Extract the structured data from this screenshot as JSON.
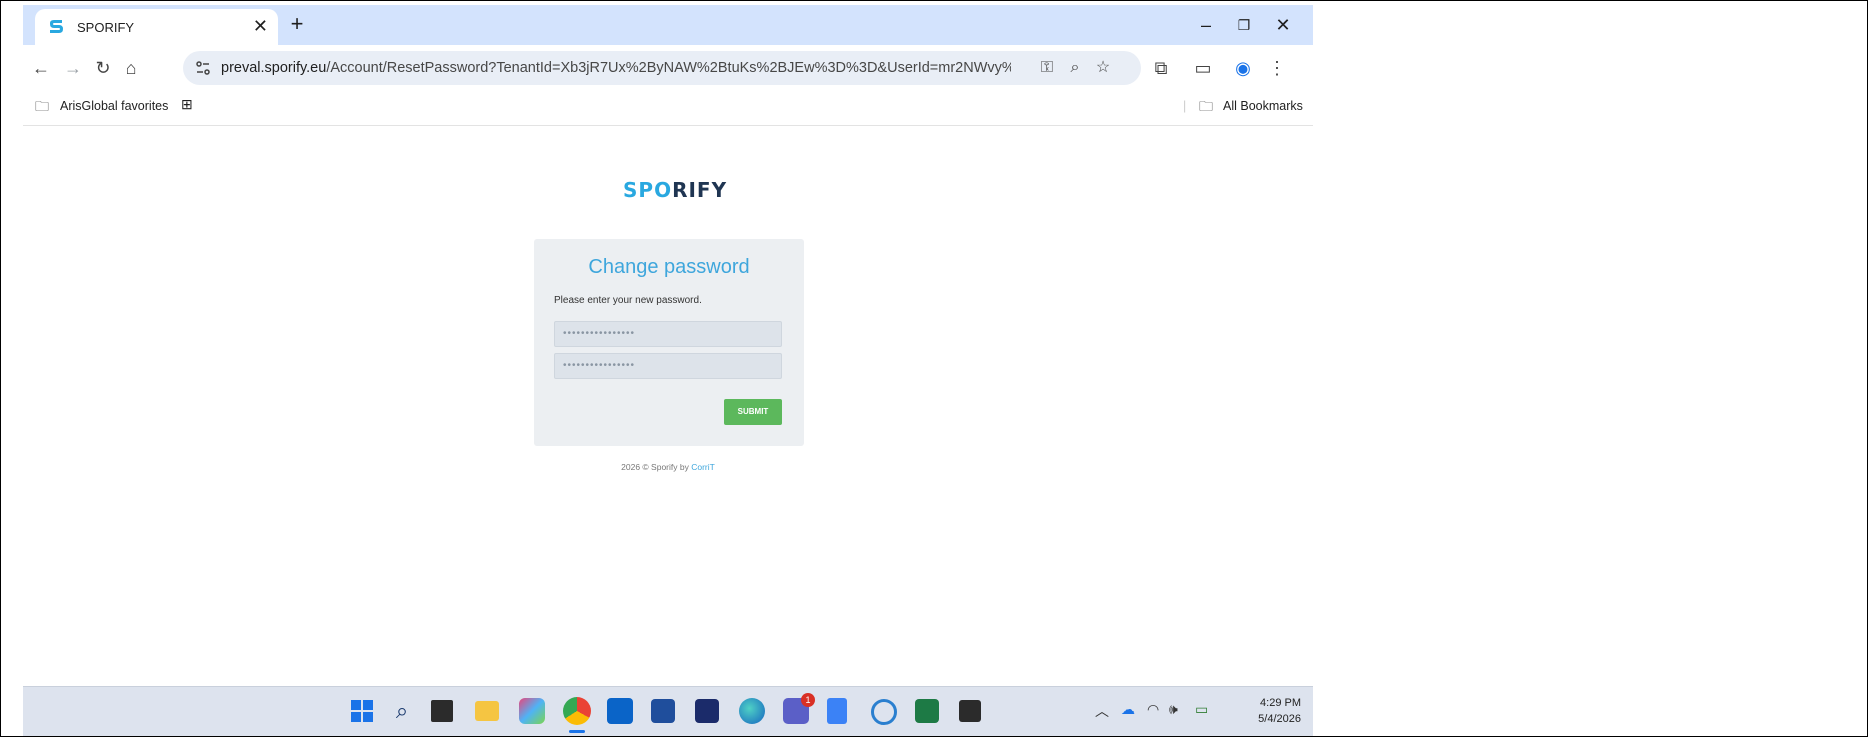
{
  "browser": {
    "tab_title": "SPORIFY",
    "url_host": "preval.sporify.eu",
    "url_path": "/Account/ResetPassword?TenantId=Xb3jR7Ux%2ByNAW%2BtuKs%2BJEw%3D%3D&UserId=mr2NWvy%2FEo..."
  },
  "bookmarks": {
    "folder_label": "ArisGlobal favorites",
    "all_bookmarks_label": "All Bookmarks"
  },
  "page": {
    "logo_prefix": "SP",
    "logo_mid": "O",
    "logo_suffix": "RIFY",
    "form_title": "Change password",
    "form_subtitle": "Please enter your new password.",
    "password_placeholder": "••••••••••••••••",
    "confirm_placeholder": "••••••••••••••••",
    "submit_label": "SUBMIT",
    "footer_prefix": "2026 © Sporify by ",
    "footer_link": "CorriT"
  },
  "taskbar": {
    "time": "4:29 PM",
    "date": "5/4/2026",
    "teams_badge": "1"
  }
}
